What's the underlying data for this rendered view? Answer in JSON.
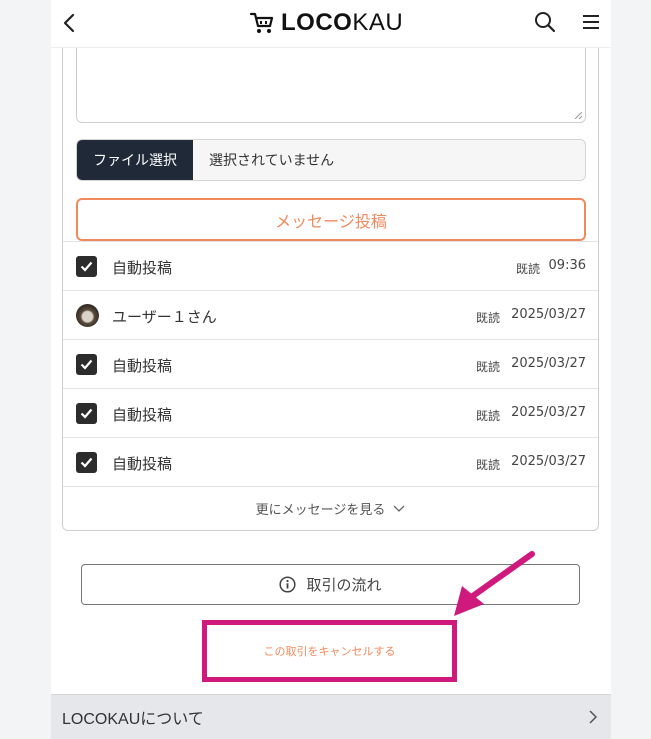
{
  "header": {
    "logo_bold": "LOCO",
    "logo_light": "KAU",
    "back_icon": "chevron-left-icon",
    "search_icon": "search-icon",
    "menu_icon": "hamburger-menu-icon"
  },
  "compose": {
    "file_button_label": "ファイル選択",
    "file_status": "選択されていません",
    "post_button_label": "メッセージ投稿"
  },
  "messages": [
    {
      "type": "auto",
      "name": "自動投稿",
      "read": "既読",
      "time": "09:36"
    },
    {
      "type": "user",
      "name": "ユーザー１さん",
      "read": "既読",
      "time": "2025/03/27"
    },
    {
      "type": "auto",
      "name": "自動投稿",
      "read": "既読",
      "time": "2025/03/27"
    },
    {
      "type": "auto",
      "name": "自動投稿",
      "read": "既読",
      "time": "2025/03/27"
    },
    {
      "type": "auto",
      "name": "自動投稿",
      "read": "既読",
      "time": "2025/03/27"
    }
  ],
  "more_messages_label": "更にメッセージを見る",
  "flow_button_label": "取引の流れ",
  "cancel_link_label": "この取引をキャンセルする",
  "footer": {
    "about_label": "LOCOKAUについて"
  },
  "colors": {
    "accent_orange": "#f08a5d",
    "highlight_magenta": "#d0197d",
    "dark_button": "#1f2937"
  }
}
